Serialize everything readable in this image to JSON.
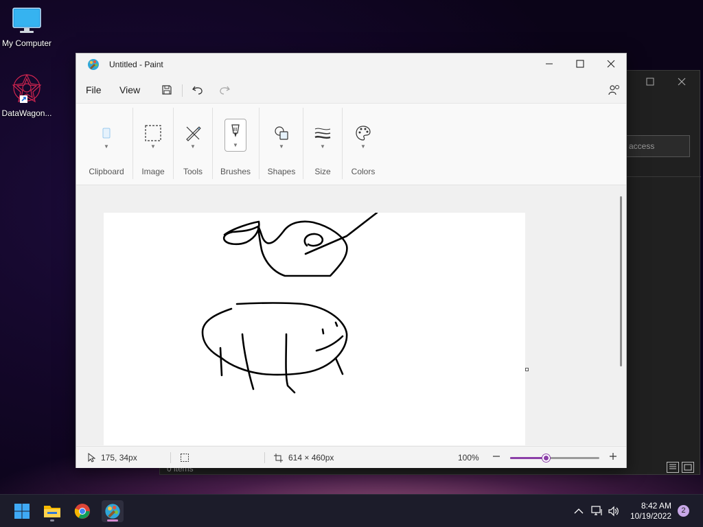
{
  "desktop": {
    "icons": [
      {
        "label": "My Computer",
        "icon": "monitor-icon"
      },
      {
        "label": "DataWagon...",
        "icon": "datawagon-logo-icon"
      }
    ]
  },
  "background_window": {
    "search_placeholder": "access",
    "status_items": "0 items"
  },
  "paint": {
    "title": "Untitled - Paint",
    "menu": {
      "file": "File",
      "view": "View"
    },
    "ribbon": {
      "clipboard": "Clipboard",
      "image": "Image",
      "tools": "Tools",
      "brushes": "Brushes",
      "shapes": "Shapes",
      "size": "Size",
      "colors": "Colors"
    },
    "status": {
      "cursor_position": "175, 34px",
      "canvas_size": "614 × 460px",
      "zoom": "100%",
      "zoom_fraction": 0.4
    },
    "accent": "#8b3fa8"
  },
  "taskbar": {
    "time": "8:42 AM",
    "date": "10/19/2022",
    "notifications": "2"
  }
}
